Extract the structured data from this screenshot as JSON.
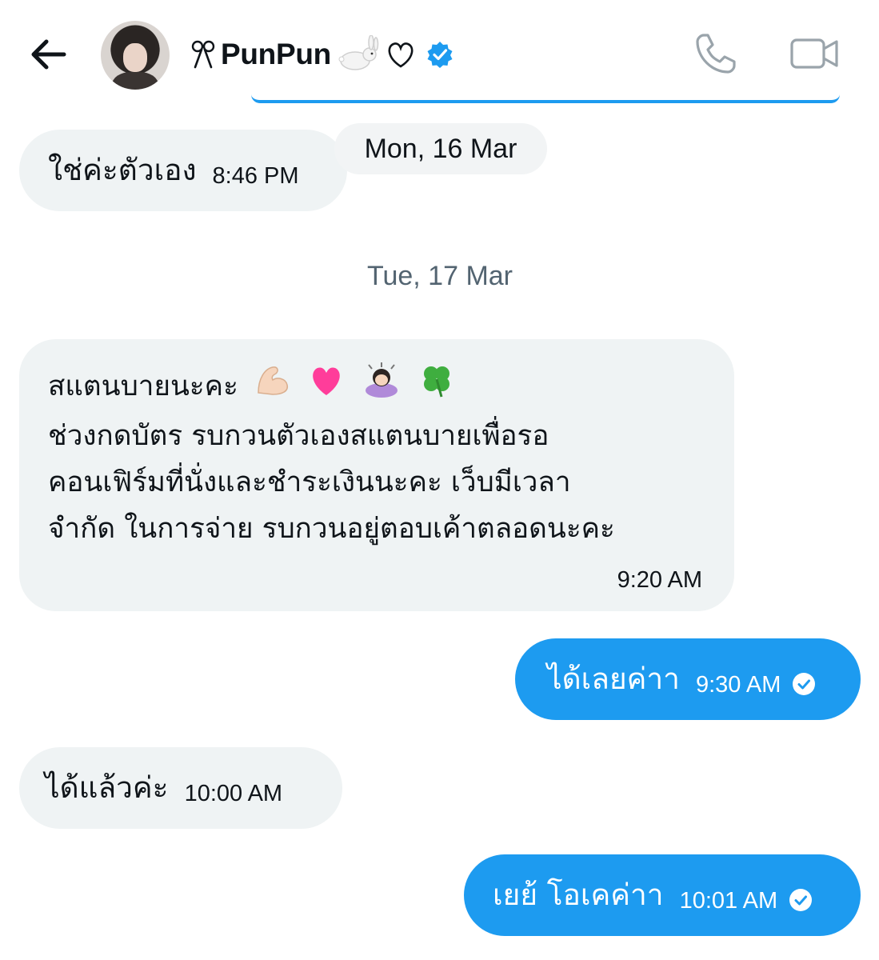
{
  "header": {
    "contact_name": "PunPun",
    "name_prefix_glyph": "๛๛",
    "icons": {
      "back": "back-arrow-icon",
      "verified": "verified-badge-icon",
      "call": "phone-icon",
      "video": "video-camera-icon"
    },
    "accent": "#1d9bf0"
  },
  "conversation": {
    "date_separators": [
      "Mon, 16 Mar",
      "Tue, 17 Mar"
    ],
    "messages": [
      {
        "direction": "incoming",
        "text": "ใช่ค่ะตัวเอง",
        "time": "8:46 PM"
      },
      {
        "direction": "incoming",
        "lines": [
          "สแตนบายนะคะ",
          "ช่วงกดบัตร รบกวนตัวเองสแตนบายเพื่อรอ",
          "คอนเฟิร์มที่นั่งและชำระเงินนะคะ เว็บมีเวลา",
          "จำกัด ในการจ่าย รบกวนอยู่ตอบเค้าตลอดนะคะ"
        ],
        "emojis": [
          "flexed-biceps-emoji",
          "pink-heart-emoji",
          "bowing-woman-emoji",
          "four-leaf-clover-emoji"
        ],
        "time": "9:20 AM"
      },
      {
        "direction": "outgoing",
        "text": "ได้เลยค่าา",
        "time": "9:30 AM",
        "status": "seen"
      },
      {
        "direction": "incoming",
        "text": "ได้แล้วค่ะ",
        "time": "10:00 AM"
      },
      {
        "direction": "outgoing",
        "text": "เยย้ โอเคค่าา",
        "time": "10:01 AM",
        "status": "seen"
      }
    ]
  }
}
